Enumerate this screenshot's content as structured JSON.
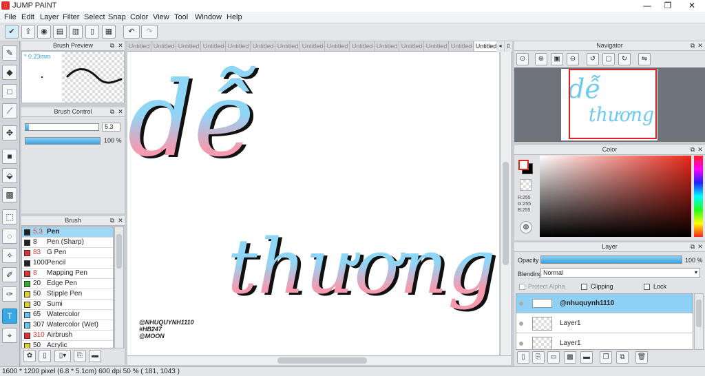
{
  "app": {
    "title": "JUMP PAINT"
  },
  "window_controls": {
    "minimize": "—",
    "maximize": "❐",
    "close": "✕"
  },
  "menu": [
    "File",
    "Edit",
    "Layer",
    "Filter",
    "Select",
    "Snap",
    "Color",
    "View",
    "Tool",
    "Window",
    "Help"
  ],
  "toolbar_icons": [
    "check-icon",
    "export-icon",
    "comment-icon",
    "chat-icon",
    "document-icon",
    "page-icon",
    "layout-icon",
    "undo-icon",
    "redo-icon"
  ],
  "brush_preview": {
    "title": "Brush Preview",
    "size": "* 0.23mm"
  },
  "brush_control": {
    "title": "Brush Control",
    "size_value": "5.3",
    "opacity_value": "100 %",
    "size_fraction": 0.05,
    "opacity_fraction": 1.0
  },
  "brush": {
    "title": "Brush",
    "items": [
      {
        "size": "5.3",
        "name": "Pen",
        "color": "#222222",
        "selected": true
      },
      {
        "size": "8",
        "name": "Pen (Sharp)",
        "color": "#222222"
      },
      {
        "size": "83",
        "name": "G Pen",
        "color": "#e03030"
      },
      {
        "size": "1000",
        "name": "Pencil",
        "color": "#222222"
      },
      {
        "size": "8",
        "name": "Mapping Pen",
        "color": "#e03030"
      },
      {
        "size": "20",
        "name": "Edge Pen",
        "color": "#30b030"
      },
      {
        "size": "50",
        "name": "Stipple Pen",
        "color": "#e0d030"
      },
      {
        "size": "30",
        "name": "Sumi",
        "color": "#e0d030"
      },
      {
        "size": "65",
        "name": "Watercolor",
        "color": "#60c8f0"
      },
      {
        "size": "307",
        "name": "Watercolor (Wet)",
        "color": "#60c8f0"
      },
      {
        "size": "310",
        "name": "Airbrush",
        "color": "#e03030"
      },
      {
        "size": "50",
        "name": "Acrylic",
        "color": "#e0d030"
      }
    ]
  },
  "tabs": [
    "Untitled",
    "Untitled",
    "Untitled",
    "Untitled",
    "Untitled",
    "Untitled",
    "Untitled",
    "Untitled",
    "Untitled",
    "Untitled",
    "Untitled",
    "Untitled",
    "Untitled",
    "Untitled",
    "Untitled"
  ],
  "canvas": {
    "text1": "dễ",
    "text2": "thương",
    "credits": [
      "@NHUQUYNH1110",
      "#HB247",
      "@MOON"
    ]
  },
  "navigator": {
    "title": "Navigator"
  },
  "color": {
    "title": "Color",
    "r": "R:255",
    "g": "G:255",
    "b": "B:255"
  },
  "layer": {
    "title": "Layer",
    "opacity_label": "Opacity",
    "opacity_value": "100 %",
    "blending_label": "Blending",
    "blending_value": "Normal",
    "protect_alpha": "Protect Alpha",
    "clipping": "Clipping",
    "lock": "Lock",
    "rows": [
      "@nhuquynh1110",
      "Layer1",
      "Layer1"
    ]
  },
  "status": {
    "text": "1600 * 1200 pixel   (6.8 * 5.1cm)   600 dpi   50 %   ( 181, 1043 )"
  }
}
